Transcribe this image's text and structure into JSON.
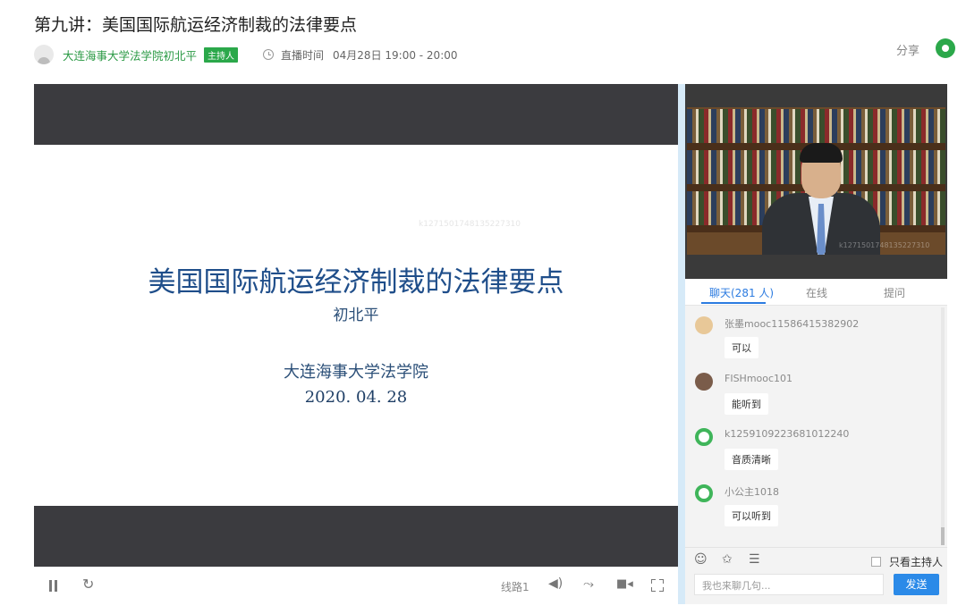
{
  "page": {
    "title": "第九讲：美国国际航运经济制裁的法律要点",
    "host_name": "大连海事大学法学院初北平",
    "host_badge": "主持人",
    "live_label": "直播时间",
    "live_time": "04月28日 19:00 - 20:00",
    "share_label": "分享"
  },
  "slide": {
    "title": "美国国际航运经济制裁的法律要点",
    "author": "初北平",
    "org": "大连海事大学法学院",
    "date": "2020. 04. 28",
    "watermark": "k1271501748135227310"
  },
  "camera": {
    "watermark": "k1271501748135227310"
  },
  "player_controls": {
    "line": "线路1"
  },
  "chat_tabs": [
    {
      "label": "聊天(281 人)",
      "active": true
    },
    {
      "label": "在线",
      "active": false
    },
    {
      "label": "提问",
      "active": false
    }
  ],
  "messages": [
    {
      "user": "张墨mooc11586415382902",
      "text": "可以",
      "avatar_color": "#d9a05b"
    },
    {
      "user": "FISHmooc101",
      "text": "能听到",
      "avatar_color": "#7a5c4a"
    },
    {
      "user": "k1259109223681012240",
      "text": "音质清晰",
      "avatar_color": "#3fb55a"
    },
    {
      "user": "小公主1018",
      "text": "可以听到",
      "avatar_color": "#3fb55a"
    }
  ],
  "chat_footer": {
    "host_only_label": "只看主持人",
    "input_placeholder": "我也来聊几句...",
    "send_label": "发送"
  },
  "icons": [
    "user-avatar-icon",
    "clock-icon",
    "wechat-icon",
    "pause-icon",
    "refresh-icon",
    "volume-icon",
    "danmaku-icon",
    "camera-icon",
    "fullscreen-icon",
    "emoji-icon",
    "star-icon",
    "list-icon"
  ],
  "colors": {
    "brand_green": "#2ba84a",
    "accent_blue": "#2b7be0",
    "send_blue": "#2b8ae8",
    "slide_blue": "#1f4e8a"
  }
}
